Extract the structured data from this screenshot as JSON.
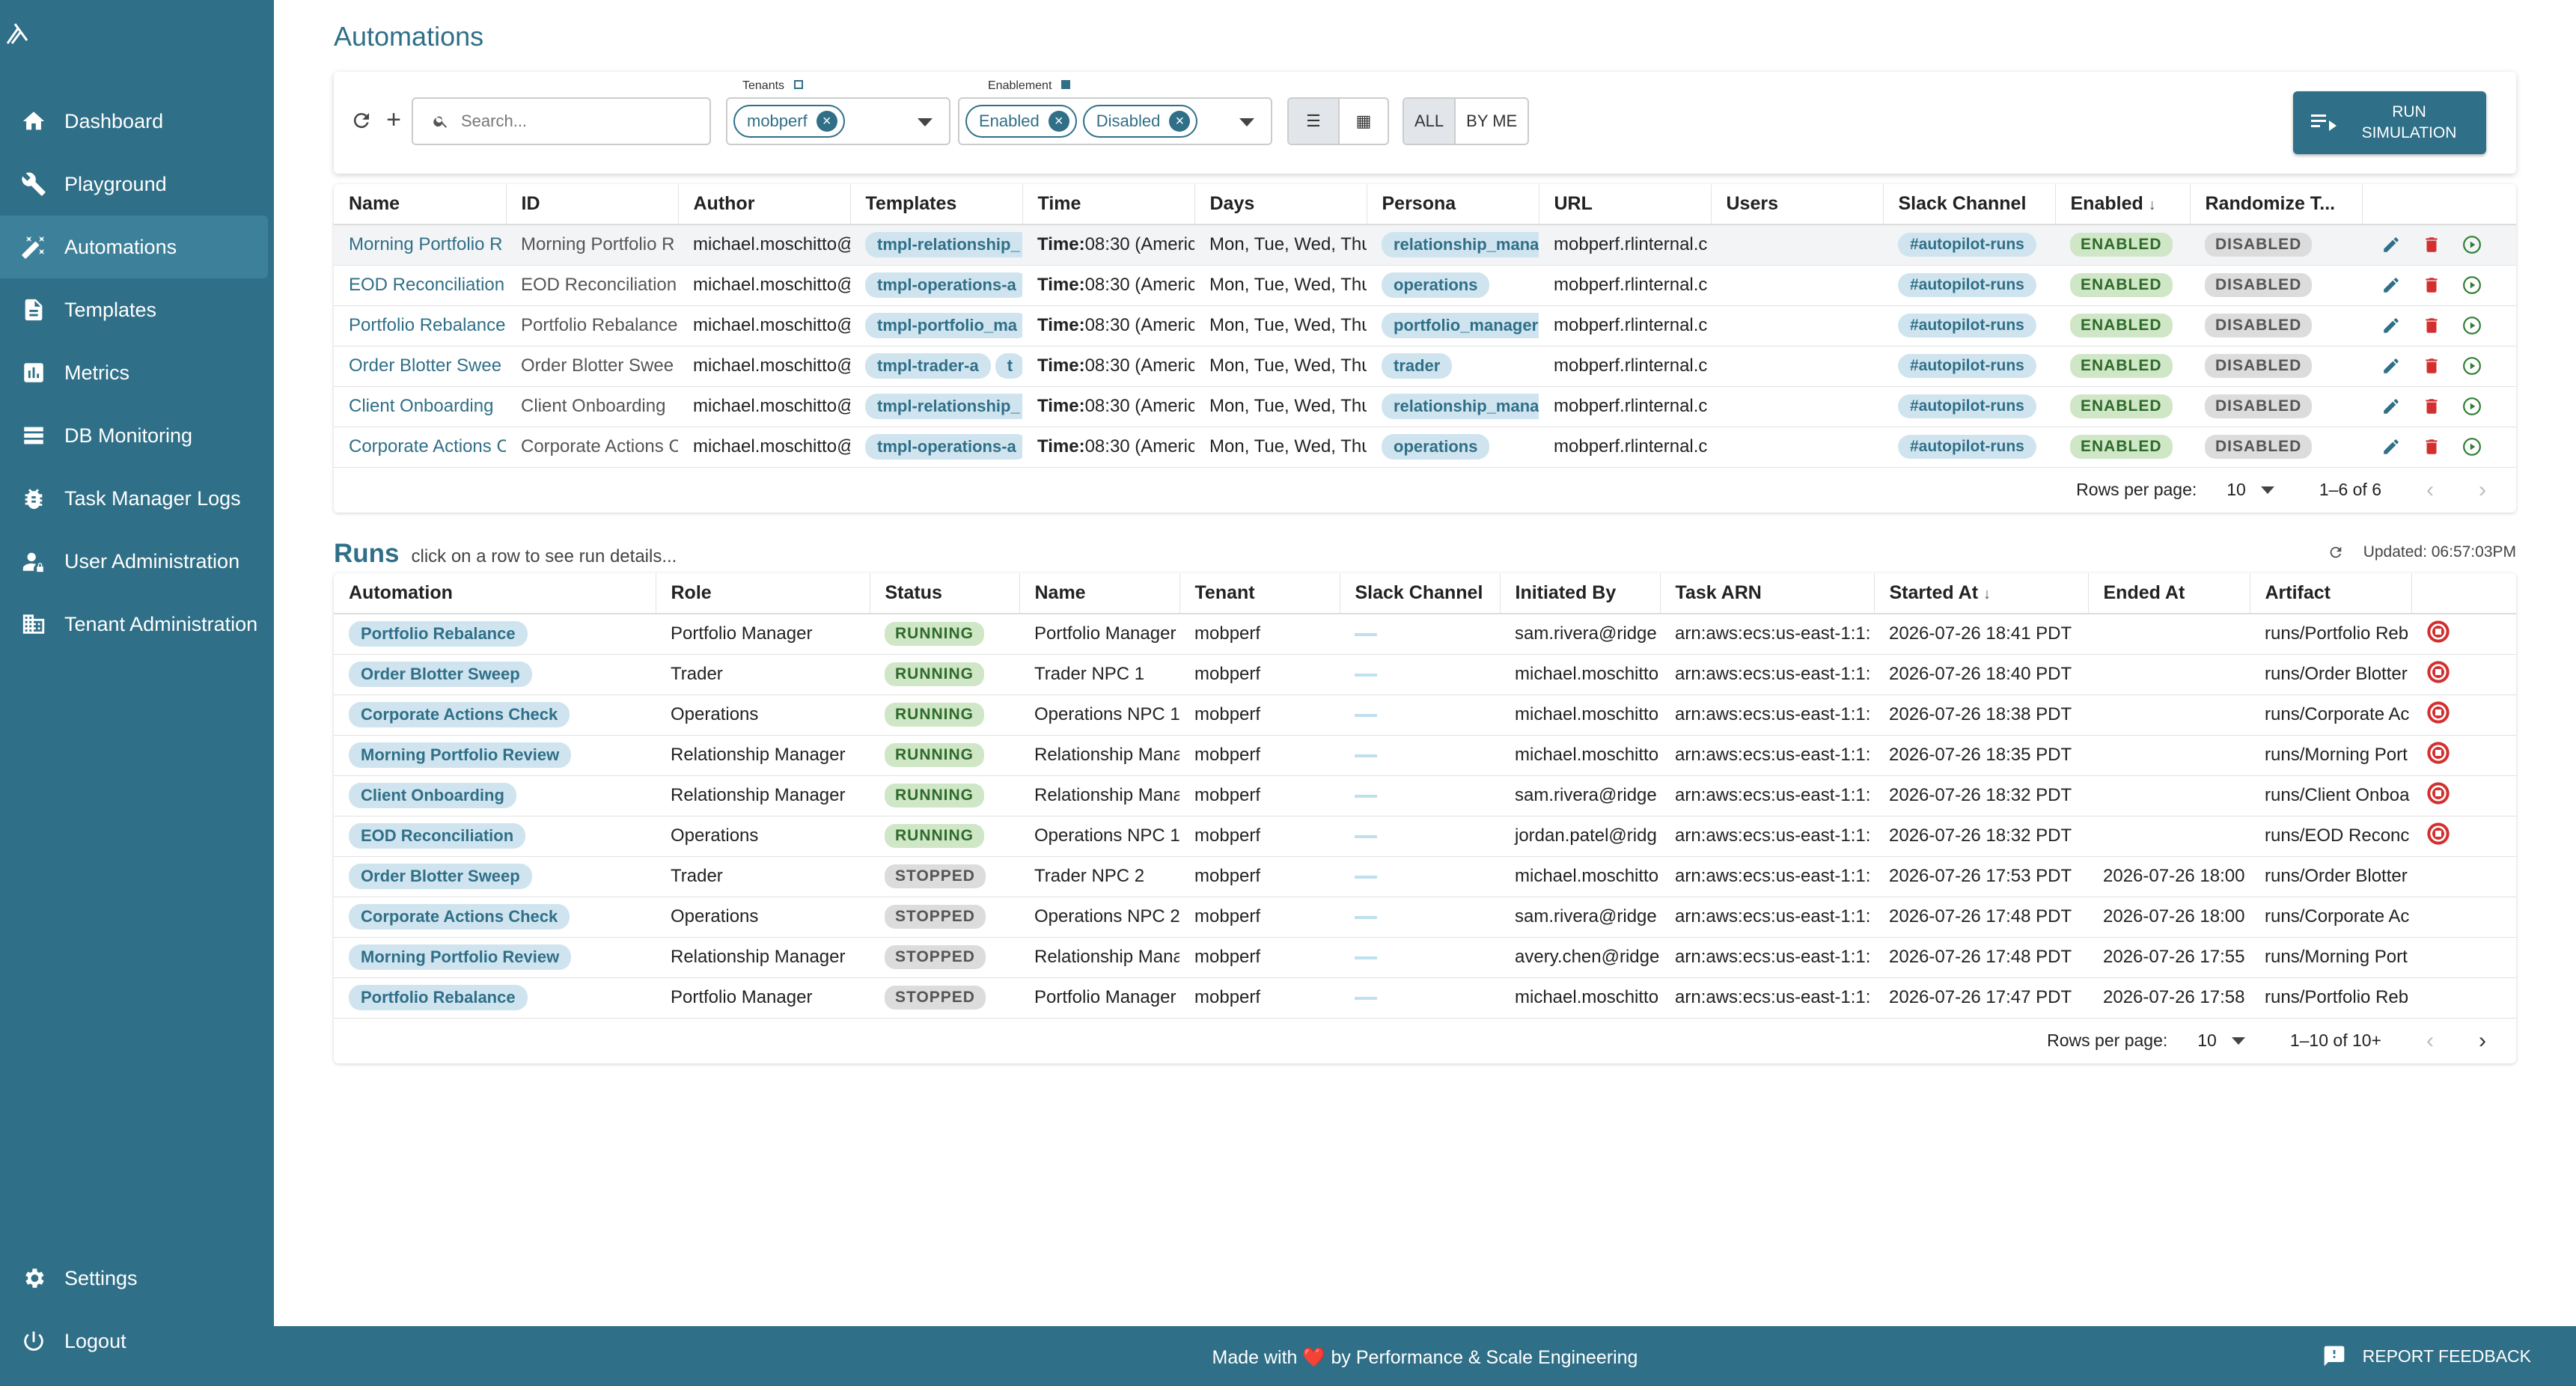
{
  "sidebar": {
    "nav": [
      {
        "label": "Dashboard",
        "icon": "home-icon"
      },
      {
        "label": "Playground",
        "icon": "tools-icon"
      },
      {
        "label": "Automations",
        "icon": "magic-wand-icon"
      },
      {
        "label": "Templates",
        "icon": "document-icon"
      },
      {
        "label": "Metrics",
        "icon": "bar-chart-icon"
      },
      {
        "label": "DB Monitoring",
        "icon": "database-list-icon"
      },
      {
        "label": "Task Manager Logs",
        "icon": "bug-icon"
      },
      {
        "label": "User Administration",
        "icon": "user-lock-icon"
      },
      {
        "label": "Tenant Administration",
        "icon": "building-icon"
      }
    ],
    "settings": "Settings",
    "logout": "Logout",
    "active": "Automations"
  },
  "page": {
    "title": "Automations"
  },
  "toolbar": {
    "search_placeholder": "Search...",
    "tenants_label": "Tenants",
    "tenants_chips": [
      "mobperf"
    ],
    "enablement_label": "Enablement",
    "enablement_chips": [
      "Enabled",
      "Disabled"
    ],
    "filter_all": "ALL",
    "filter_by_me": "BY ME",
    "run_simulation": "RUN SIMULATION"
  },
  "automations_table": {
    "columns": [
      "Name",
      "ID",
      "Author",
      "Templates",
      "Time",
      "Days",
      "Persona",
      "URL",
      "Users",
      "Slack Channel",
      "Enabled",
      "Randomize T..."
    ],
    "rows": [
      {
        "name": "Morning Portfolio R",
        "id": "Morning Portfolio R",
        "author": "michael.moschitto@",
        "template": "tmpl-relationship_",
        "time_label": "Time:",
        "time": "08:30 (Americ",
        "days": "Mon, Tue, Wed, Thu",
        "persona": "relationship_mana",
        "url": "mobperf.rlinternal.c",
        "users": "",
        "slack": "#autopilot-runs",
        "enabled": "ENABLED",
        "randomize": "DISABLED"
      },
      {
        "name": "EOD Reconciliation",
        "id": "EOD Reconciliation",
        "author": "michael.moschitto@",
        "template": "tmpl-operations-a",
        "time_label": "Time:",
        "time": "08:30 (Americ",
        "days": "Mon, Tue, Wed, Thu",
        "persona": "operations",
        "url": "mobperf.rlinternal.c",
        "users": "",
        "slack": "#autopilot-runs",
        "enabled": "ENABLED",
        "randomize": "DISABLED"
      },
      {
        "name": "Portfolio Rebalance",
        "id": "Portfolio Rebalance",
        "author": "michael.moschitto@",
        "template": "tmpl-portfolio_ma",
        "time_label": "Time:",
        "time": "08:30 (Americ",
        "days": "Mon, Tue, Wed, Thu",
        "persona": "portfolio_manager",
        "url": "mobperf.rlinternal.c",
        "users": "",
        "slack": "#autopilot-runs",
        "enabled": "ENABLED",
        "randomize": "DISABLED"
      },
      {
        "name": "Order Blotter Swee",
        "id": "Order Blotter Swee",
        "author": "michael.moschitto@",
        "template": "tmpl-trader-a",
        "template2": "t",
        "time_label": "Time:",
        "time": "08:30 (Americ",
        "days": "Mon, Tue, Wed, Thu",
        "persona": "trader",
        "url": "mobperf.rlinternal.c",
        "users": "",
        "slack": "#autopilot-runs",
        "enabled": "ENABLED",
        "randomize": "DISABLED"
      },
      {
        "name": "Client Onboarding",
        "id": "Client Onboarding",
        "author": "michael.moschitto@",
        "template": "tmpl-relationship_",
        "time_label": "Time:",
        "time": "08:30 (Americ",
        "days": "Mon, Tue, Wed, Thu",
        "persona": "relationship_mana",
        "url": "mobperf.rlinternal.c",
        "users": "",
        "slack": "#autopilot-runs",
        "enabled": "ENABLED",
        "randomize": "DISABLED"
      },
      {
        "name": "Corporate Actions C",
        "id": "Corporate Actions C",
        "author": "michael.moschitto@",
        "template": "tmpl-operations-a",
        "time_label": "Time:",
        "time": "08:30 (Americ",
        "days": "Mon, Tue, Wed, Thu",
        "persona": "operations",
        "url": "mobperf.rlinternal.c",
        "users": "",
        "slack": "#autopilot-runs",
        "enabled": "ENABLED",
        "randomize": "DISABLED"
      }
    ],
    "rows_per_page_label": "Rows per page:",
    "rows_per_page": "10",
    "range": "1–6 of 6"
  },
  "runs": {
    "title": "Runs",
    "subtitle": "click on a row to see run details...",
    "updated": "Updated: 06:57:03PM",
    "columns": [
      "Automation",
      "Role",
      "Status",
      "Name",
      "Tenant",
      "Slack Channel",
      "Initiated By",
      "Task ARN",
      "Started At",
      "Ended At",
      "Artifact"
    ],
    "rows": [
      {
        "automation": "Portfolio Rebalance",
        "role": "Portfolio Manager",
        "status": "RUNNING",
        "name": "Portfolio Manager",
        "tenant": "mobperf",
        "initiated_by": "sam.rivera@ridge",
        "arn": "arn:aws:ecs:us-east-1:1:",
        "started": "2026-07-26 18:41 PDT",
        "ended": "",
        "artifact": "runs/Portfolio Reb"
      },
      {
        "automation": "Order Blotter Sweep",
        "role": "Trader",
        "status": "RUNNING",
        "name": "Trader NPC 1",
        "tenant": "mobperf",
        "initiated_by": "michael.moschitto",
        "arn": "arn:aws:ecs:us-east-1:1:",
        "started": "2026-07-26 18:40 PDT",
        "ended": "",
        "artifact": "runs/Order Blotter"
      },
      {
        "automation": "Corporate Actions Check",
        "role": "Operations",
        "status": "RUNNING",
        "name": "Operations NPC 1",
        "tenant": "mobperf",
        "initiated_by": "michael.moschitto",
        "arn": "arn:aws:ecs:us-east-1:1:",
        "started": "2026-07-26 18:38 PDT",
        "ended": "",
        "artifact": "runs/Corporate Ac"
      },
      {
        "automation": "Morning Portfolio Review",
        "role": "Relationship Manager",
        "status": "RUNNING",
        "name": "Relationship Mana",
        "tenant": "mobperf",
        "initiated_by": "michael.moschitto",
        "arn": "arn:aws:ecs:us-east-1:1:",
        "started": "2026-07-26 18:35 PDT",
        "ended": "",
        "artifact": "runs/Morning Port"
      },
      {
        "automation": "Client Onboarding",
        "role": "Relationship Manager",
        "status": "RUNNING",
        "name": "Relationship Mana",
        "tenant": "mobperf",
        "initiated_by": "sam.rivera@ridge",
        "arn": "arn:aws:ecs:us-east-1:1:",
        "started": "2026-07-26 18:32 PDT",
        "ended": "",
        "artifact": "runs/Client Onboa"
      },
      {
        "automation": "EOD Reconciliation",
        "role": "Operations",
        "status": "RUNNING",
        "name": "Operations NPC 1",
        "tenant": "mobperf",
        "initiated_by": "jordan.patel@ridg",
        "arn": "arn:aws:ecs:us-east-1:1:",
        "started": "2026-07-26 18:32 PDT",
        "ended": "",
        "artifact": "runs/EOD Reconc"
      },
      {
        "automation": "Order Blotter Sweep",
        "role": "Trader",
        "status": "STOPPED",
        "name": "Trader NPC 2",
        "tenant": "mobperf",
        "initiated_by": "michael.moschitto",
        "arn": "arn:aws:ecs:us-east-1:1:",
        "started": "2026-07-26 17:53 PDT",
        "ended": "2026-07-26 18:00",
        "artifact": "runs/Order Blotter"
      },
      {
        "automation": "Corporate Actions Check",
        "role": "Operations",
        "status": "STOPPED",
        "name": "Operations NPC 2",
        "tenant": "mobperf",
        "initiated_by": "sam.rivera@ridge",
        "arn": "arn:aws:ecs:us-east-1:1:",
        "started": "2026-07-26 17:48 PDT",
        "ended": "2026-07-26 18:00",
        "artifact": "runs/Corporate Ac"
      },
      {
        "automation": "Morning Portfolio Review",
        "role": "Relationship Manager",
        "status": "STOPPED",
        "name": "Relationship Mana",
        "tenant": "mobperf",
        "initiated_by": "avery.chen@ridge",
        "arn": "arn:aws:ecs:us-east-1:1:",
        "started": "2026-07-26 17:48 PDT",
        "ended": "2026-07-26 17:55",
        "artifact": "runs/Morning Port"
      },
      {
        "automation": "Portfolio Rebalance",
        "role": "Portfolio Manager",
        "status": "STOPPED",
        "name": "Portfolio Manager",
        "tenant": "mobperf",
        "initiated_by": "michael.moschitto",
        "arn": "arn:aws:ecs:us-east-1:1:",
        "started": "2026-07-26 17:47 PDT",
        "ended": "2026-07-26 17:58",
        "artifact": "runs/Portfolio Reb"
      }
    ],
    "rows_per_page_label": "Rows per page:",
    "rows_per_page": "10",
    "range": "1–10 of 10+"
  },
  "footer": {
    "made_with": "Made with",
    "heart": "❤️",
    "by": "by Performance & Scale Engineering",
    "feedback": "REPORT FEEDBACK"
  },
  "colors": {
    "brand": "#2f6f87",
    "enabled_bg": "#cfe7c6",
    "disabled_bg": "#dcdcdc",
    "danger": "#d32f2f",
    "play": "#2e7d32"
  }
}
